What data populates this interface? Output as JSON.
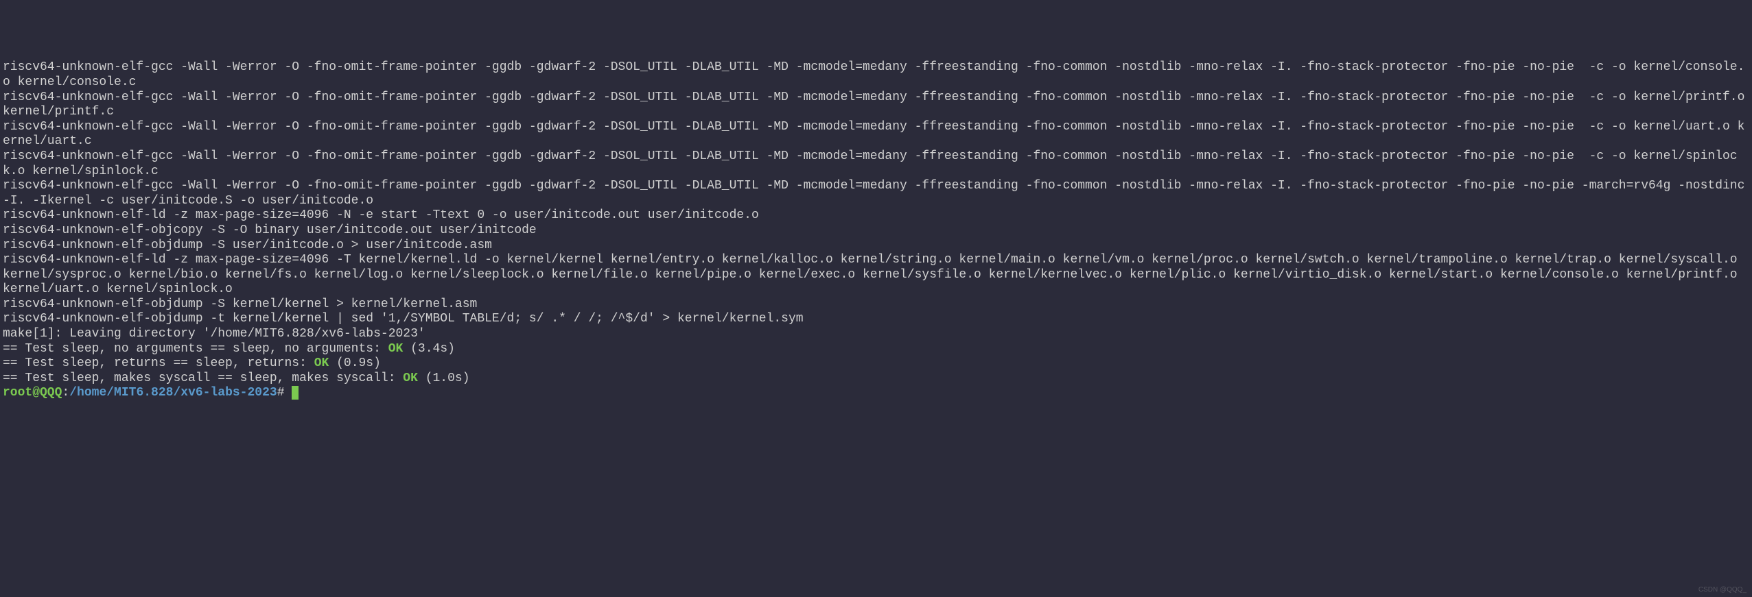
{
  "terminal": {
    "lines": [
      "riscv64-unknown-elf-gcc -Wall -Werror -O -fno-omit-frame-pointer -ggdb -gdwarf-2 -DSOL_UTIL -DLAB_UTIL -MD -mcmodel=medany -ffreestanding -fno-common -nostdlib -mno-relax -I. -fno-stack-protector -fno-pie -no-pie  -c -o kernel/console.o kernel/console.c",
      "riscv64-unknown-elf-gcc -Wall -Werror -O -fno-omit-frame-pointer -ggdb -gdwarf-2 -DSOL_UTIL -DLAB_UTIL -MD -mcmodel=medany -ffreestanding -fno-common -nostdlib -mno-relax -I. -fno-stack-protector -fno-pie -no-pie  -c -o kernel/printf.o kernel/printf.c",
      "riscv64-unknown-elf-gcc -Wall -Werror -O -fno-omit-frame-pointer -ggdb -gdwarf-2 -DSOL_UTIL -DLAB_UTIL -MD -mcmodel=medany -ffreestanding -fno-common -nostdlib -mno-relax -I. -fno-stack-protector -fno-pie -no-pie  -c -o kernel/uart.o kernel/uart.c",
      "riscv64-unknown-elf-gcc -Wall -Werror -O -fno-omit-frame-pointer -ggdb -gdwarf-2 -DSOL_UTIL -DLAB_UTIL -MD -mcmodel=medany -ffreestanding -fno-common -nostdlib -mno-relax -I. -fno-stack-protector -fno-pie -no-pie  -c -o kernel/spinlock.o kernel/spinlock.c",
      "riscv64-unknown-elf-gcc -Wall -Werror -O -fno-omit-frame-pointer -ggdb -gdwarf-2 -DSOL_UTIL -DLAB_UTIL -MD -mcmodel=medany -ffreestanding -fno-common -nostdlib -mno-relax -I. -fno-stack-protector -fno-pie -no-pie -march=rv64g -nostdinc -I. -Ikernel -c user/initcode.S -o user/initcode.o",
      "riscv64-unknown-elf-ld -z max-page-size=4096 -N -e start -Ttext 0 -o user/initcode.out user/initcode.o",
      "riscv64-unknown-elf-objcopy -S -O binary user/initcode.out user/initcode",
      "riscv64-unknown-elf-objdump -S user/initcode.o > user/initcode.asm",
      "riscv64-unknown-elf-ld -z max-page-size=4096 -T kernel/kernel.ld -o kernel/kernel kernel/entry.o kernel/kalloc.o kernel/string.o kernel/main.o kernel/vm.o kernel/proc.o kernel/swtch.o kernel/trampoline.o kernel/trap.o kernel/syscall.o kernel/sysproc.o kernel/bio.o kernel/fs.o kernel/log.o kernel/sleeplock.o kernel/file.o kernel/pipe.o kernel/exec.o kernel/sysfile.o kernel/kernelvec.o kernel/plic.o kernel/virtio_disk.o kernel/start.o kernel/console.o kernel/printf.o kernel/uart.o kernel/spinlock.o",
      "riscv64-unknown-elf-objdump -S kernel/kernel > kernel/kernel.asm",
      "riscv64-unknown-elf-objdump -t kernel/kernel | sed '1,/SYMBOL TABLE/d; s/ .* / /; /^$/d' > kernel/kernel.sym",
      "make[1]: Leaving directory '/home/MIT6.828/xv6-labs-2023'"
    ],
    "tests": [
      {
        "prefix": "== Test sleep, no arguments == sleep, no arguments: ",
        "status": "OK",
        "suffix": " (3.4s)"
      },
      {
        "prefix": "== Test sleep, returns == sleep, returns: ",
        "status": "OK",
        "suffix": " (0.9s)"
      },
      {
        "prefix": "== Test sleep, makes syscall == sleep, makes syscall: ",
        "status": "OK",
        "suffix": " (1.0s)"
      }
    ],
    "prompt": {
      "user_host": "root@QQQ",
      "colon": ":",
      "path": "/home/MIT6.828/xv6-labs-2023",
      "symbol": "#"
    },
    "watermark": "CSDN @QQQ_"
  }
}
